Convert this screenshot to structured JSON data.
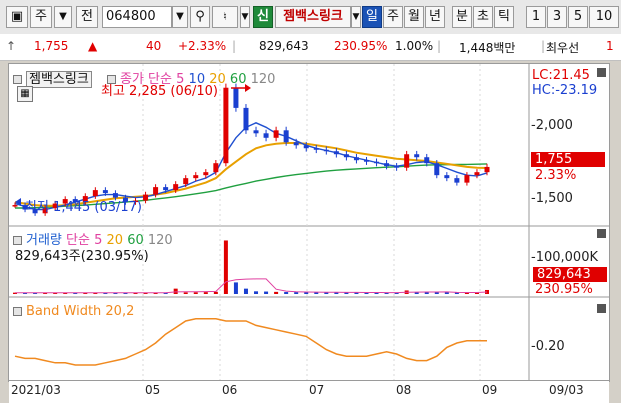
{
  "toolbar": {
    "market": "주",
    "prev_label": "전",
    "code": "064800",
    "new_label": "신",
    "pattern": "젬백스링크",
    "periods": [
      "일",
      "주",
      "월",
      "년",
      "분",
      "초",
      "틱"
    ],
    "active_period": "일",
    "numbers": [
      "1",
      "3",
      "5",
      "10"
    ]
  },
  "info": {
    "price": "1,755",
    "change": "40",
    "change_pct": "+2.33%",
    "volume": "829,643",
    "volume_ratio": "230.95%",
    "rate": "1.00%",
    "amount": "1,448백만",
    "rank": "최우선",
    "extra": "1"
  },
  "colors": {
    "up": "#e00000",
    "down": "#1a3fd0",
    "ma5": "#e040a0",
    "ma10": "#2050d0",
    "ma20": "#e8a000",
    "ma60": "#20a040",
    "ma120": "#888888",
    "band": "#f08a20"
  },
  "price_panel": {
    "title": "젬백스링크",
    "legend_prefix": "종가 단순",
    "ma_periods": [
      "5",
      "10",
      "20",
      "60",
      "120"
    ],
    "high_note": "최고 2,285 (06/10)",
    "low_note": "최저 1,445 (03/17)",
    "lc_label": "LC:21.45",
    "hc_label": "HC:-23.19",
    "y_ticks": [
      "2,000",
      "1,500"
    ],
    "current_price": "1,755",
    "current_pct": "2.33%"
  },
  "volume_panel": {
    "title": "거래량",
    "legend_prefix": "단순",
    "ma_periods": [
      "5",
      "20",
      "60",
      "120"
    ],
    "summary": "829,643주(230.95%)",
    "y_tick": "100,000K",
    "current_volume": "829,643",
    "current_pct": "230.95%"
  },
  "band_panel": {
    "title": "Band Width 20,2",
    "y_tick": "0.20"
  },
  "x_axis": [
    "2021/03",
    "05",
    "06",
    "07",
    "08",
    "09",
    "09/03"
  ],
  "chart_data": {
    "type": "line",
    "title": "젬백스링크",
    "x_range": [
      "2021/03",
      "2021/09/03"
    ],
    "price": {
      "ylim": [
        1400,
        2350
      ],
      "close": [
        1500,
        1470,
        1445,
        1480,
        1510,
        1540,
        1520,
        1560,
        1600,
        1580,
        1550,
        1520,
        1530,
        1570,
        1620,
        1600,
        1640,
        1680,
        1700,
        1720,
        1780,
        2285,
        2150,
        2000,
        1980,
        1950,
        2000,
        1920,
        1900,
        1880,
        1870,
        1860,
        1840,
        1820,
        1800,
        1790,
        1780,
        1760,
        1750,
        1840,
        1820,
        1780,
        1700,
        1680,
        1650,
        1700,
        1720,
        1755
      ],
      "ma5": [
        1510,
        1490,
        1470,
        1470,
        1485,
        1500,
        1520,
        1540,
        1560,
        1570,
        1570,
        1560,
        1550,
        1555,
        1570,
        1590,
        1610,
        1630,
        1660,
        1680,
        1720,
        1850,
        1950,
        2020,
        2050,
        2020,
        1980,
        1960,
        1930,
        1900,
        1880,
        1865,
        1850,
        1830,
        1815,
        1800,
        1785,
        1770,
        1760,
        1770,
        1785,
        1790,
        1770,
        1745,
        1720,
        1700,
        1695,
        1715
      ],
      "ma20": [
        1520,
        1510,
        1500,
        1495,
        1495,
        1500,
        1505,
        1515,
        1525,
        1535,
        1545,
        1550,
        1555,
        1560,
        1570,
        1580,
        1595,
        1610,
        1630,
        1650,
        1680,
        1740,
        1790,
        1840,
        1880,
        1900,
        1910,
        1915,
        1915,
        1910,
        1900,
        1890,
        1880,
        1865,
        1850,
        1840,
        1830,
        1820,
        1810,
        1805,
        1800,
        1795,
        1785,
        1775,
        1765,
        1755,
        1750,
        1748
      ],
      "ma60": [
        1480,
        1480,
        1482,
        1485,
        1488,
        1492,
        1496,
        1500,
        1505,
        1510,
        1515,
        1520,
        1526,
        1532,
        1540,
        1548,
        1556,
        1565,
        1575,
        1585,
        1597,
        1615,
        1630,
        1645,
        1660,
        1672,
        1684,
        1695,
        1704,
        1712,
        1720,
        1727,
        1733,
        1738,
        1742,
        1746,
        1750,
        1753,
        1756,
        1760,
        1764,
        1767,
        1769,
        1770,
        1771,
        1772,
        1773,
        1775
      ]
    },
    "volume": {
      "ylim": [
        0,
        130000
      ],
      "values": [
        3000,
        2500,
        2800,
        3200,
        2600,
        2400,
        2900,
        3100,
        2700,
        2500,
        3300,
        2900,
        2600,
        2800,
        3000,
        3400,
        12000,
        3600,
        3800,
        4200,
        5000,
        120000,
        26000,
        12000,
        6000,
        5500,
        4800,
        4400,
        4200,
        4000,
        3800,
        3600,
        3500,
        3400,
        3300,
        3200,
        3100,
        3000,
        3200,
        8000,
        4200,
        3800,
        3600,
        3400,
        3300,
        3200,
        3100,
        9000
      ]
    },
    "band_width": {
      "y_tick": 0.2,
      "values": [
        0.14,
        0.13,
        0.13,
        0.12,
        0.11,
        0.11,
        0.1,
        0.1,
        0.1,
        0.11,
        0.12,
        0.13,
        0.15,
        0.17,
        0.2,
        0.24,
        0.27,
        0.3,
        0.31,
        0.31,
        0.31,
        0.3,
        0.3,
        0.3,
        0.28,
        0.27,
        0.26,
        0.25,
        0.24,
        0.23,
        0.2,
        0.17,
        0.15,
        0.14,
        0.14,
        0.14,
        0.15,
        0.16,
        0.15,
        0.13,
        0.12,
        0.12,
        0.14,
        0.18,
        0.2,
        0.21,
        0.21,
        0.21
      ]
    }
  }
}
